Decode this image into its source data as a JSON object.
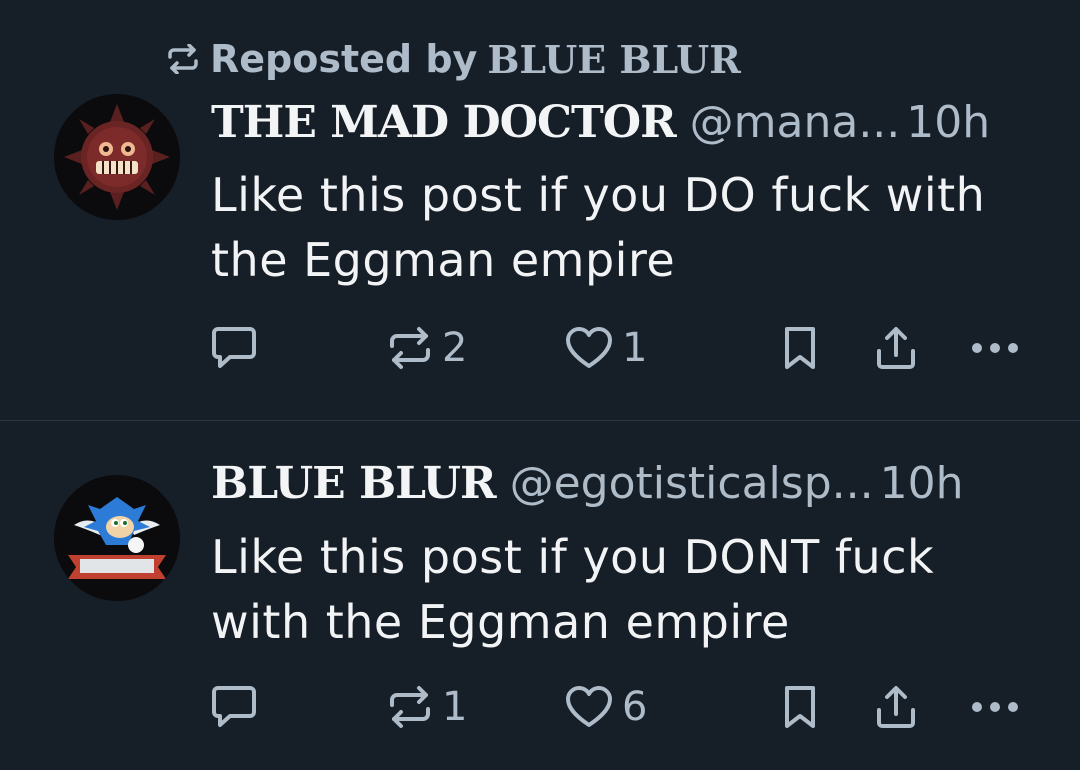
{
  "colors": {
    "background": "#161e27",
    "text_primary": "#f1f3f5",
    "text_secondary": "#aebbc9",
    "divider": "#2b3642"
  },
  "repost_banner": {
    "label": "Reposted by",
    "by_name": "BLUE BLUR",
    "icon": "repost-icon"
  },
  "posts": [
    {
      "avatar_icon": "eggman-emblem-avatar",
      "display_name": "THE MAD DOCTOR",
      "handle": "@mana...",
      "time": "10h",
      "text": "Like this post if you DO fuck with the Eggman empire",
      "actions": {
        "reply_icon": "reply-icon",
        "repost_count": "2",
        "like_count": "1",
        "bookmark_icon": "bookmark-icon",
        "share_icon": "share-icon",
        "more_icon": "more-icon"
      }
    },
    {
      "avatar_icon": "sonic-emblem-avatar",
      "display_name": "BLUE BLUR",
      "handle": "@egotisticalsp...",
      "time": "10h",
      "text": "Like this post if you DONT fuck with the Eggman empire",
      "actions": {
        "reply_icon": "reply-icon",
        "repost_count": "1",
        "like_count": "6",
        "bookmark_icon": "bookmark-icon",
        "share_icon": "share-icon",
        "more_icon": "more-icon"
      }
    }
  ]
}
